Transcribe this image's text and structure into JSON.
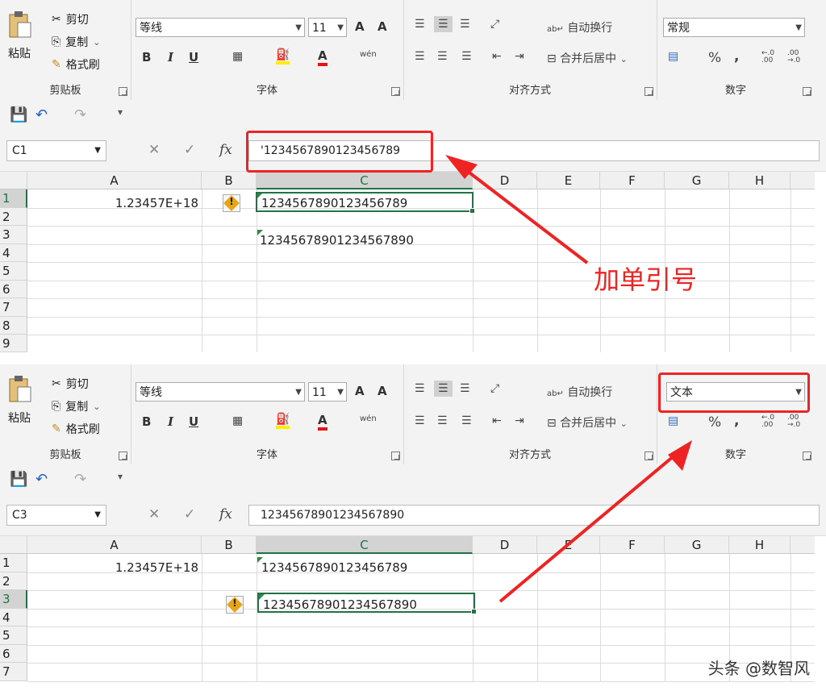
{
  "ribbon": {
    "clipboard": {
      "paste": "粘贴",
      "cut": "剪切",
      "copy": "复制",
      "format_painter": "格式刷",
      "group_label": "剪贴板"
    },
    "font": {
      "name": "等线",
      "size": "11",
      "group_label": "字体",
      "bold": "B",
      "italic": "I",
      "underline": "U",
      "grow": "A",
      "shrink": "A",
      "font_color": "A",
      "phonetic": "wén"
    },
    "alignment": {
      "wrap": "自动换行",
      "merge": "合并后居中",
      "group_label": "对齐方式"
    },
    "number": {
      "group_label": "数字",
      "percent": "%",
      "comma": ",",
      "inc_decimal": "←.0 .00",
      "dec_decimal": ".00 →.0"
    }
  },
  "panels": [
    {
      "number_format": "常规",
      "name_box": "C1",
      "formula": "'1234567890123456789",
      "columns": [
        "A",
        "B",
        "C",
        "D",
        "E",
        "F",
        "G",
        "H"
      ],
      "rows": [
        "1",
        "2",
        "3",
        "4",
        "5",
        "6",
        "7",
        "8",
        "9"
      ],
      "cells": {
        "A1": "1.23457E+18",
        "C1": "1234567890123456789",
        "C3": "12345678901234567890"
      }
    },
    {
      "number_format": "文本",
      "name_box": "C3",
      "formula": "12345678901234567890",
      "columns": [
        "A",
        "B",
        "C",
        "D",
        "E",
        "F",
        "G",
        "H"
      ],
      "rows": [
        "1",
        "2",
        "3",
        "4",
        "5",
        "6",
        "7"
      ],
      "cells": {
        "A1": "1.23457E+18",
        "C1": "1234567890123456789",
        "C3": "12345678901234567890"
      }
    }
  ],
  "annotation": "加单引号",
  "watermark": "头条 @数智风",
  "colors": {
    "annotation_red": "#ee2424",
    "excel_green": "#217346",
    "indicator_green": "#2e8b3e",
    "warn_amber": "#e8a418"
  }
}
